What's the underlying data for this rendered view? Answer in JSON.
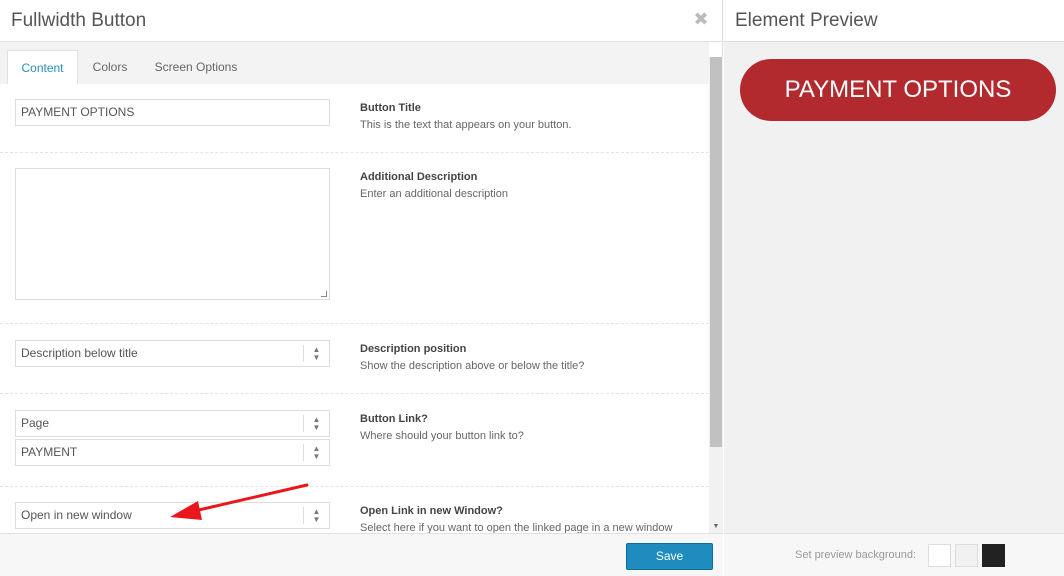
{
  "modal": {
    "title": "Fullwidth Button",
    "close_icon": "close-icon"
  },
  "tabs": [
    {
      "label": "Content",
      "active": true
    },
    {
      "label": "Colors",
      "active": false
    },
    {
      "label": "Screen Options",
      "active": false
    }
  ],
  "fields": {
    "button_title": {
      "value": "PAYMENT OPTIONS",
      "label": "Button Title",
      "desc": "This is the text that appears on your button."
    },
    "additional_description": {
      "value": "",
      "label": "Additional Description",
      "desc": "Enter an additional description"
    },
    "description_position": {
      "value": "Description below title",
      "label": "Description position",
      "desc": "Show the description above or below the title?"
    },
    "button_link": {
      "value_type": "Page",
      "value_page": "PAYMENT",
      "label": "Button Link?",
      "desc": "Where should your button link to?"
    },
    "open_new_window": {
      "value": "Open in new window",
      "label": "Open Link in new Window?",
      "desc": "Select here if you want to open the linked page in a new window"
    }
  },
  "footer": {
    "save_label": "Save"
  },
  "preview": {
    "title": "Element Preview",
    "button_text": "PAYMENT OPTIONS",
    "button_color": "#b22a2e",
    "bg_label": "Set preview background:",
    "swatches": [
      "#ffffff",
      "#f1f1f1",
      "#222222"
    ]
  },
  "annotation": {
    "arrow_color": "#e8171b"
  }
}
